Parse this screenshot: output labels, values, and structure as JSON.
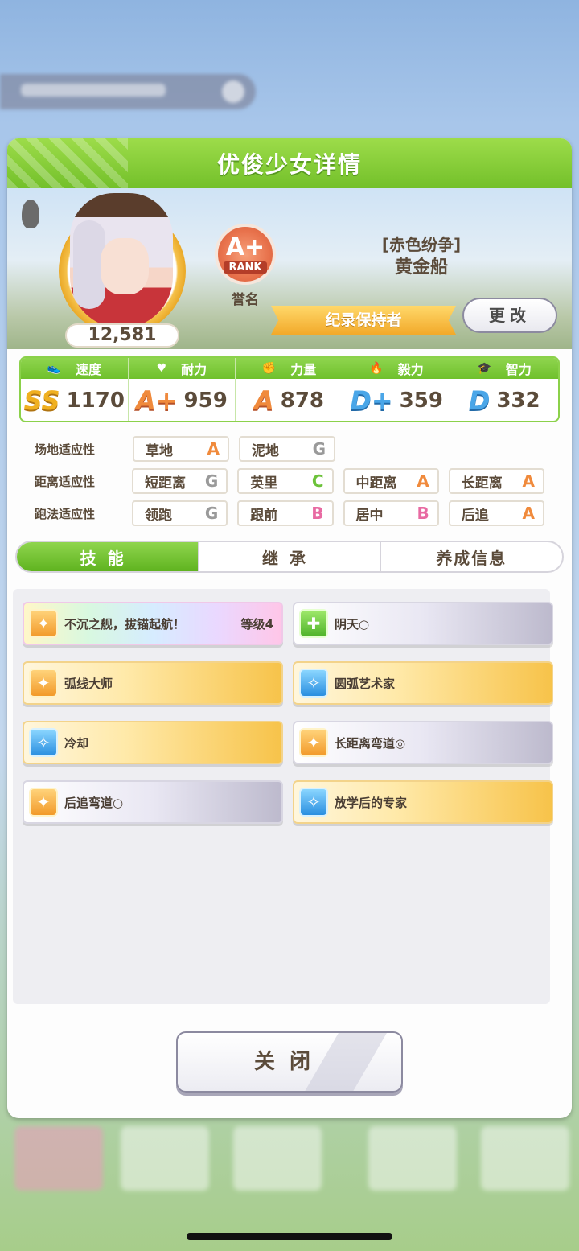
{
  "panel": {
    "title": "优俊少女详情"
  },
  "hero": {
    "score": "12,581",
    "rank": {
      "grade": "A+",
      "word": "RANK",
      "label": "誉名"
    },
    "character": {
      "title": "[赤色纷争]",
      "name": "黄金船"
    },
    "title_ribbon": "纪录保持者",
    "change_button": "更改"
  },
  "stats": [
    {
      "name": "速度",
      "icon": "shoe-icon",
      "grade": "SS",
      "value": "1170"
    },
    {
      "name": "耐力",
      "icon": "heart-icon",
      "grade": "A+",
      "value": "959"
    },
    {
      "name": "力量",
      "icon": "muscle-icon",
      "grade": "A",
      "value": "878"
    },
    {
      "name": "毅力",
      "icon": "flame-icon",
      "grade": "D+",
      "value": "359"
    },
    {
      "name": "智力",
      "icon": "graduation-cap-icon",
      "grade": "D",
      "value": "332"
    }
  ],
  "aptitude": {
    "track": {
      "label": "场地适应性",
      "items": [
        {
          "name": "草地",
          "grade": "A"
        },
        {
          "name": "泥地",
          "grade": "G"
        }
      ]
    },
    "distance": {
      "label": "距离适应性",
      "items": [
        {
          "name": "短距离",
          "grade": "G"
        },
        {
          "name": "英里",
          "grade": "C"
        },
        {
          "name": "中距离",
          "grade": "A"
        },
        {
          "name": "长距离",
          "grade": "A"
        }
      ]
    },
    "style": {
      "label": "跑法适应性",
      "items": [
        {
          "name": "领跑",
          "grade": "G"
        },
        {
          "name": "跟前",
          "grade": "B"
        },
        {
          "name": "居中",
          "grade": "B"
        },
        {
          "name": "后追",
          "grade": "A"
        }
      ]
    }
  },
  "tabs": [
    "技能",
    "继承",
    "养成信息"
  ],
  "skills": [
    {
      "name": "不沉之舰，拔锚起航！",
      "level": "等级4",
      "style": "rainbow",
      "icon": "speed-skill-icon"
    },
    {
      "name": "阴天○",
      "level": "",
      "style": "white",
      "icon": "heal-skill-icon"
    },
    {
      "name": "弧线大师",
      "level": "",
      "style": "gold",
      "icon": "speed-skill-icon"
    },
    {
      "name": "圆弧艺术家",
      "level": "",
      "style": "gold",
      "icon": "recover-skill-icon"
    },
    {
      "name": "冷却",
      "level": "",
      "style": "gold",
      "icon": "recover-skill-icon"
    },
    {
      "name": "长距离弯道◎",
      "level": "",
      "style": "white",
      "icon": "speed-skill-icon"
    },
    {
      "name": "后追弯道○",
      "level": "",
      "style": "white",
      "icon": "speed-skill-icon"
    },
    {
      "name": "放学后的专家",
      "level": "",
      "style": "gold",
      "icon": "recover-skill-icon"
    }
  ],
  "close_button": "关闭"
}
